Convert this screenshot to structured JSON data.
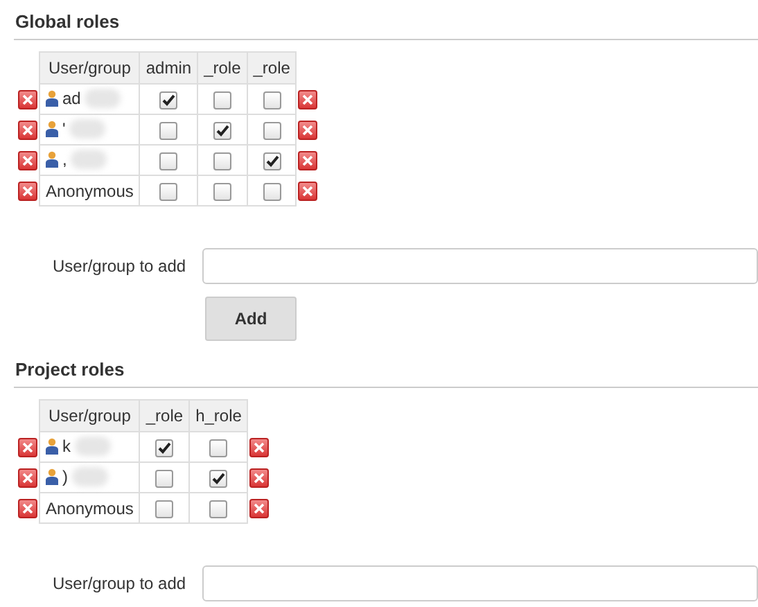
{
  "sections": [
    {
      "title": "Global roles",
      "columns": [
        "User/group",
        "admin",
        "_role",
        "_role"
      ],
      "rows": [
        {
          "kind": "user",
          "name": "ad",
          "checked": [
            true,
            false,
            false
          ]
        },
        {
          "kind": "user",
          "name": "'",
          "checked": [
            false,
            true,
            false
          ]
        },
        {
          "kind": "user",
          "name": ",",
          "checked": [
            false,
            false,
            true
          ]
        },
        {
          "kind": "anonymous",
          "name": "Anonymous",
          "checked": [
            false,
            false,
            false
          ]
        }
      ],
      "add_label": "User/group to add",
      "add_button": "Add"
    },
    {
      "title": "Project roles",
      "columns": [
        "User/group",
        "_role",
        "h_role"
      ],
      "rows": [
        {
          "kind": "user",
          "name": "k",
          "checked": [
            true,
            false
          ]
        },
        {
          "kind": "user",
          "name": ")",
          "checked": [
            false,
            true
          ]
        },
        {
          "kind": "anonymous",
          "name": "Anonymous",
          "checked": [
            false,
            false
          ]
        }
      ],
      "add_label": "User/group to add"
    }
  ]
}
